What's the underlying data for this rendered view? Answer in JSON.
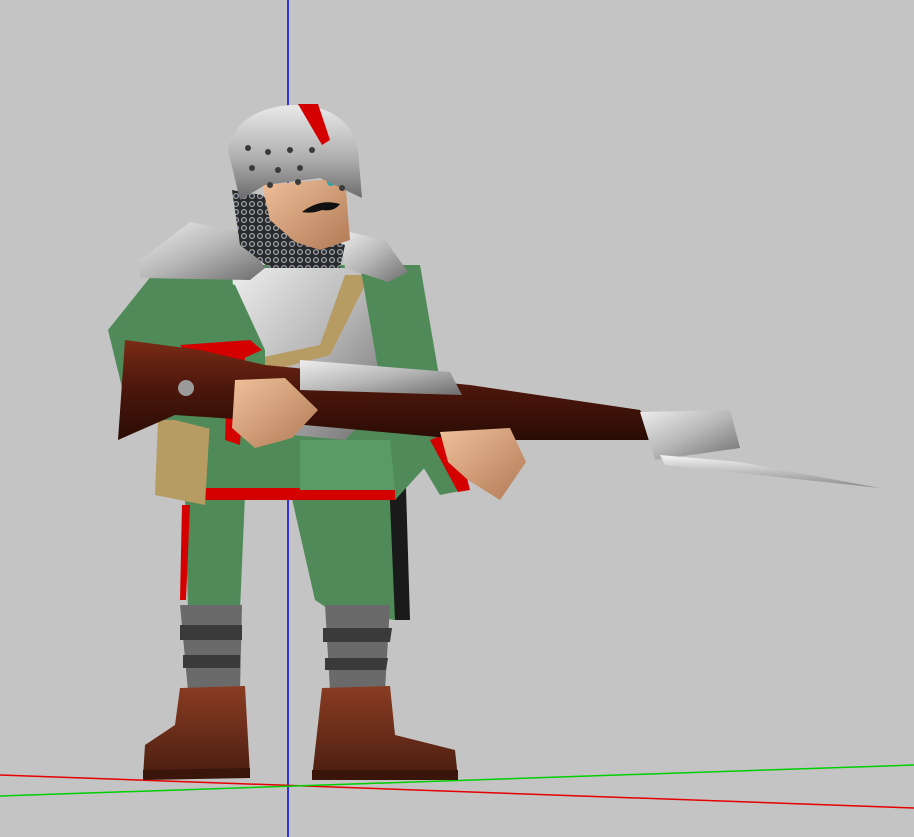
{
  "viewport": {
    "background": "#c4c4c4",
    "axis_colors": {
      "x": "#e60000",
      "y": "#0000e6",
      "z": "#00d000"
    }
  },
  "model": {
    "subject": "soldier-model",
    "palette": {
      "helmet": "#b8b8b8",
      "helmet_stripe": "#d40000",
      "uniform": "#4f8a58",
      "uniform_trim": "#d40000",
      "armor": "#c7c7c7",
      "strap": "#b69b63",
      "skin": "#d9a57a",
      "hair": "#1b1b1b",
      "rifle_wood": "#5a1c0e",
      "metal": "#d8d8d8",
      "boots": "#6e2e1a",
      "greaves": "#5a5a5a"
    }
  }
}
